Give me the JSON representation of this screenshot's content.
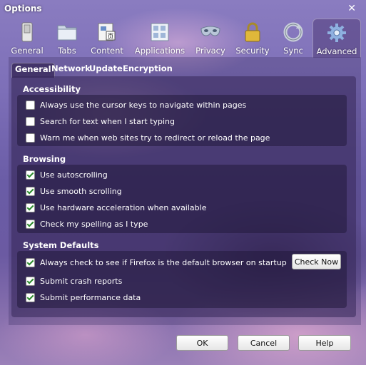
{
  "window": {
    "title": "Options",
    "close_glyph": "✕"
  },
  "panes": [
    {
      "label": "General",
      "icon": "switch-icon"
    },
    {
      "label": "Tabs",
      "icon": "folder-tabs-icon"
    },
    {
      "label": "Content",
      "icon": "content-page-icon"
    },
    {
      "label": "Applications",
      "icon": "applications-grid-icon"
    },
    {
      "label": "Privacy",
      "icon": "mask-icon"
    },
    {
      "label": "Security",
      "icon": "padlock-icon"
    },
    {
      "label": "Sync",
      "icon": "sync-icon"
    },
    {
      "label": "Advanced",
      "icon": "gear-icon",
      "active": true
    }
  ],
  "subtabs": [
    {
      "label": "General",
      "active": true
    },
    {
      "label": "Network"
    },
    {
      "label": "Update"
    },
    {
      "label": "Encryption"
    }
  ],
  "accessibility": {
    "title": "Accessibility",
    "options": [
      {
        "label": "Always use the cursor keys to navigate within pages",
        "checked": false
      },
      {
        "label": "Search for text when I start typing",
        "checked": false
      },
      {
        "label": "Warn me when web sites try to redirect or reload the page",
        "checked": false
      }
    ]
  },
  "browsing": {
    "title": "Browsing",
    "options": [
      {
        "label": "Use autoscrolling",
        "checked": true
      },
      {
        "label": "Use smooth scrolling",
        "checked": true
      },
      {
        "label": "Use hardware acceleration when available",
        "checked": true
      },
      {
        "label": "Check my spelling as I type",
        "checked": true
      }
    ]
  },
  "system_defaults": {
    "title": "System Defaults",
    "options": [
      {
        "label": "Always check to see if Firefox is the default browser on startup",
        "checked": true
      },
      {
        "label": "Submit crash reports",
        "checked": true
      },
      {
        "label": "Submit performance data",
        "checked": true
      }
    ],
    "check_now_label": "Check Now"
  },
  "buttons": {
    "ok": "OK",
    "cancel": "Cancel",
    "help": "Help"
  }
}
